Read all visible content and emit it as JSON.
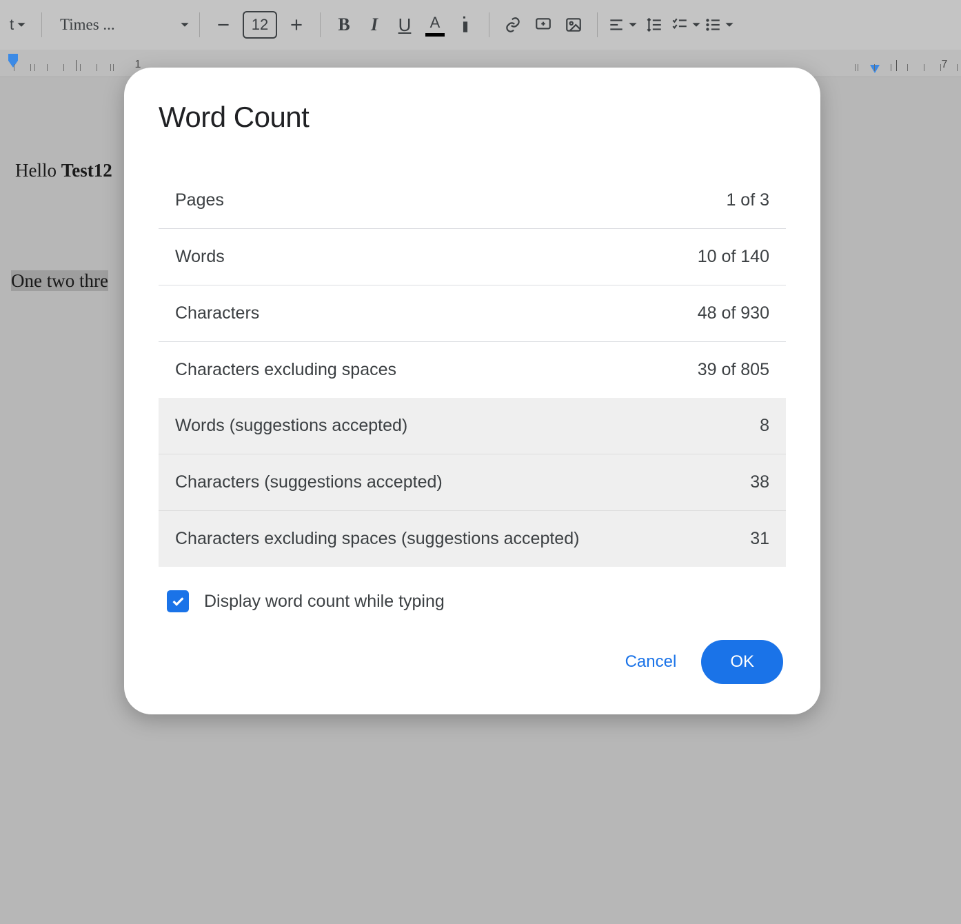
{
  "toolbar": {
    "firstchar": "t",
    "font_name": "Times ...",
    "font_size": "12",
    "bold": "B",
    "italic": "I",
    "underline": "U",
    "textcolor": "A"
  },
  "ruler": {
    "num_left": "1",
    "num_right": "7"
  },
  "document": {
    "line1_a": "Hello ",
    "line1_b": "Test12",
    "line2": "One two thre"
  },
  "dialog": {
    "title": "Word Count",
    "rows": [
      {
        "label": "Pages",
        "value": "1 of 3"
      },
      {
        "label": "Words",
        "value": "10 of 140"
      },
      {
        "label": "Characters",
        "value": "48 of 930"
      },
      {
        "label": "Characters excluding spaces",
        "value": "39 of 805"
      }
    ],
    "sugg_rows": [
      {
        "label": "Words (suggestions accepted)",
        "value": "8"
      },
      {
        "label": "Characters (suggestions accepted)",
        "value": "38"
      },
      {
        "label": "Characters excluding spaces (suggestions accepted)",
        "value": "31"
      }
    ],
    "checkbox_label": "Display word count while typing",
    "checkbox_checked": true,
    "cancel": "Cancel",
    "ok": "OK"
  }
}
